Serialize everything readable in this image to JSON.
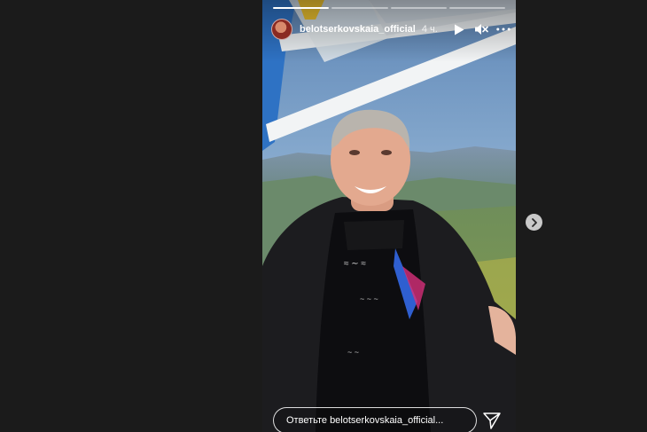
{
  "story": {
    "username": "belotserkovskaia_official",
    "timestamp": "4 ч.",
    "progress": {
      "segments": 4,
      "current": 1
    },
    "reply_placeholder": "Ответьте belotserkovskaia_official...",
    "icons": {
      "play": "play-icon",
      "mute": "muted-speaker-icon",
      "more": "more-options-icon",
      "send": "send-icon",
      "next": "chevron-right-icon"
    }
  },
  "colors": {
    "page_background": "#1b1b1b",
    "ride_frame": "#2e72c4",
    "sky": "#8fb3d7"
  }
}
